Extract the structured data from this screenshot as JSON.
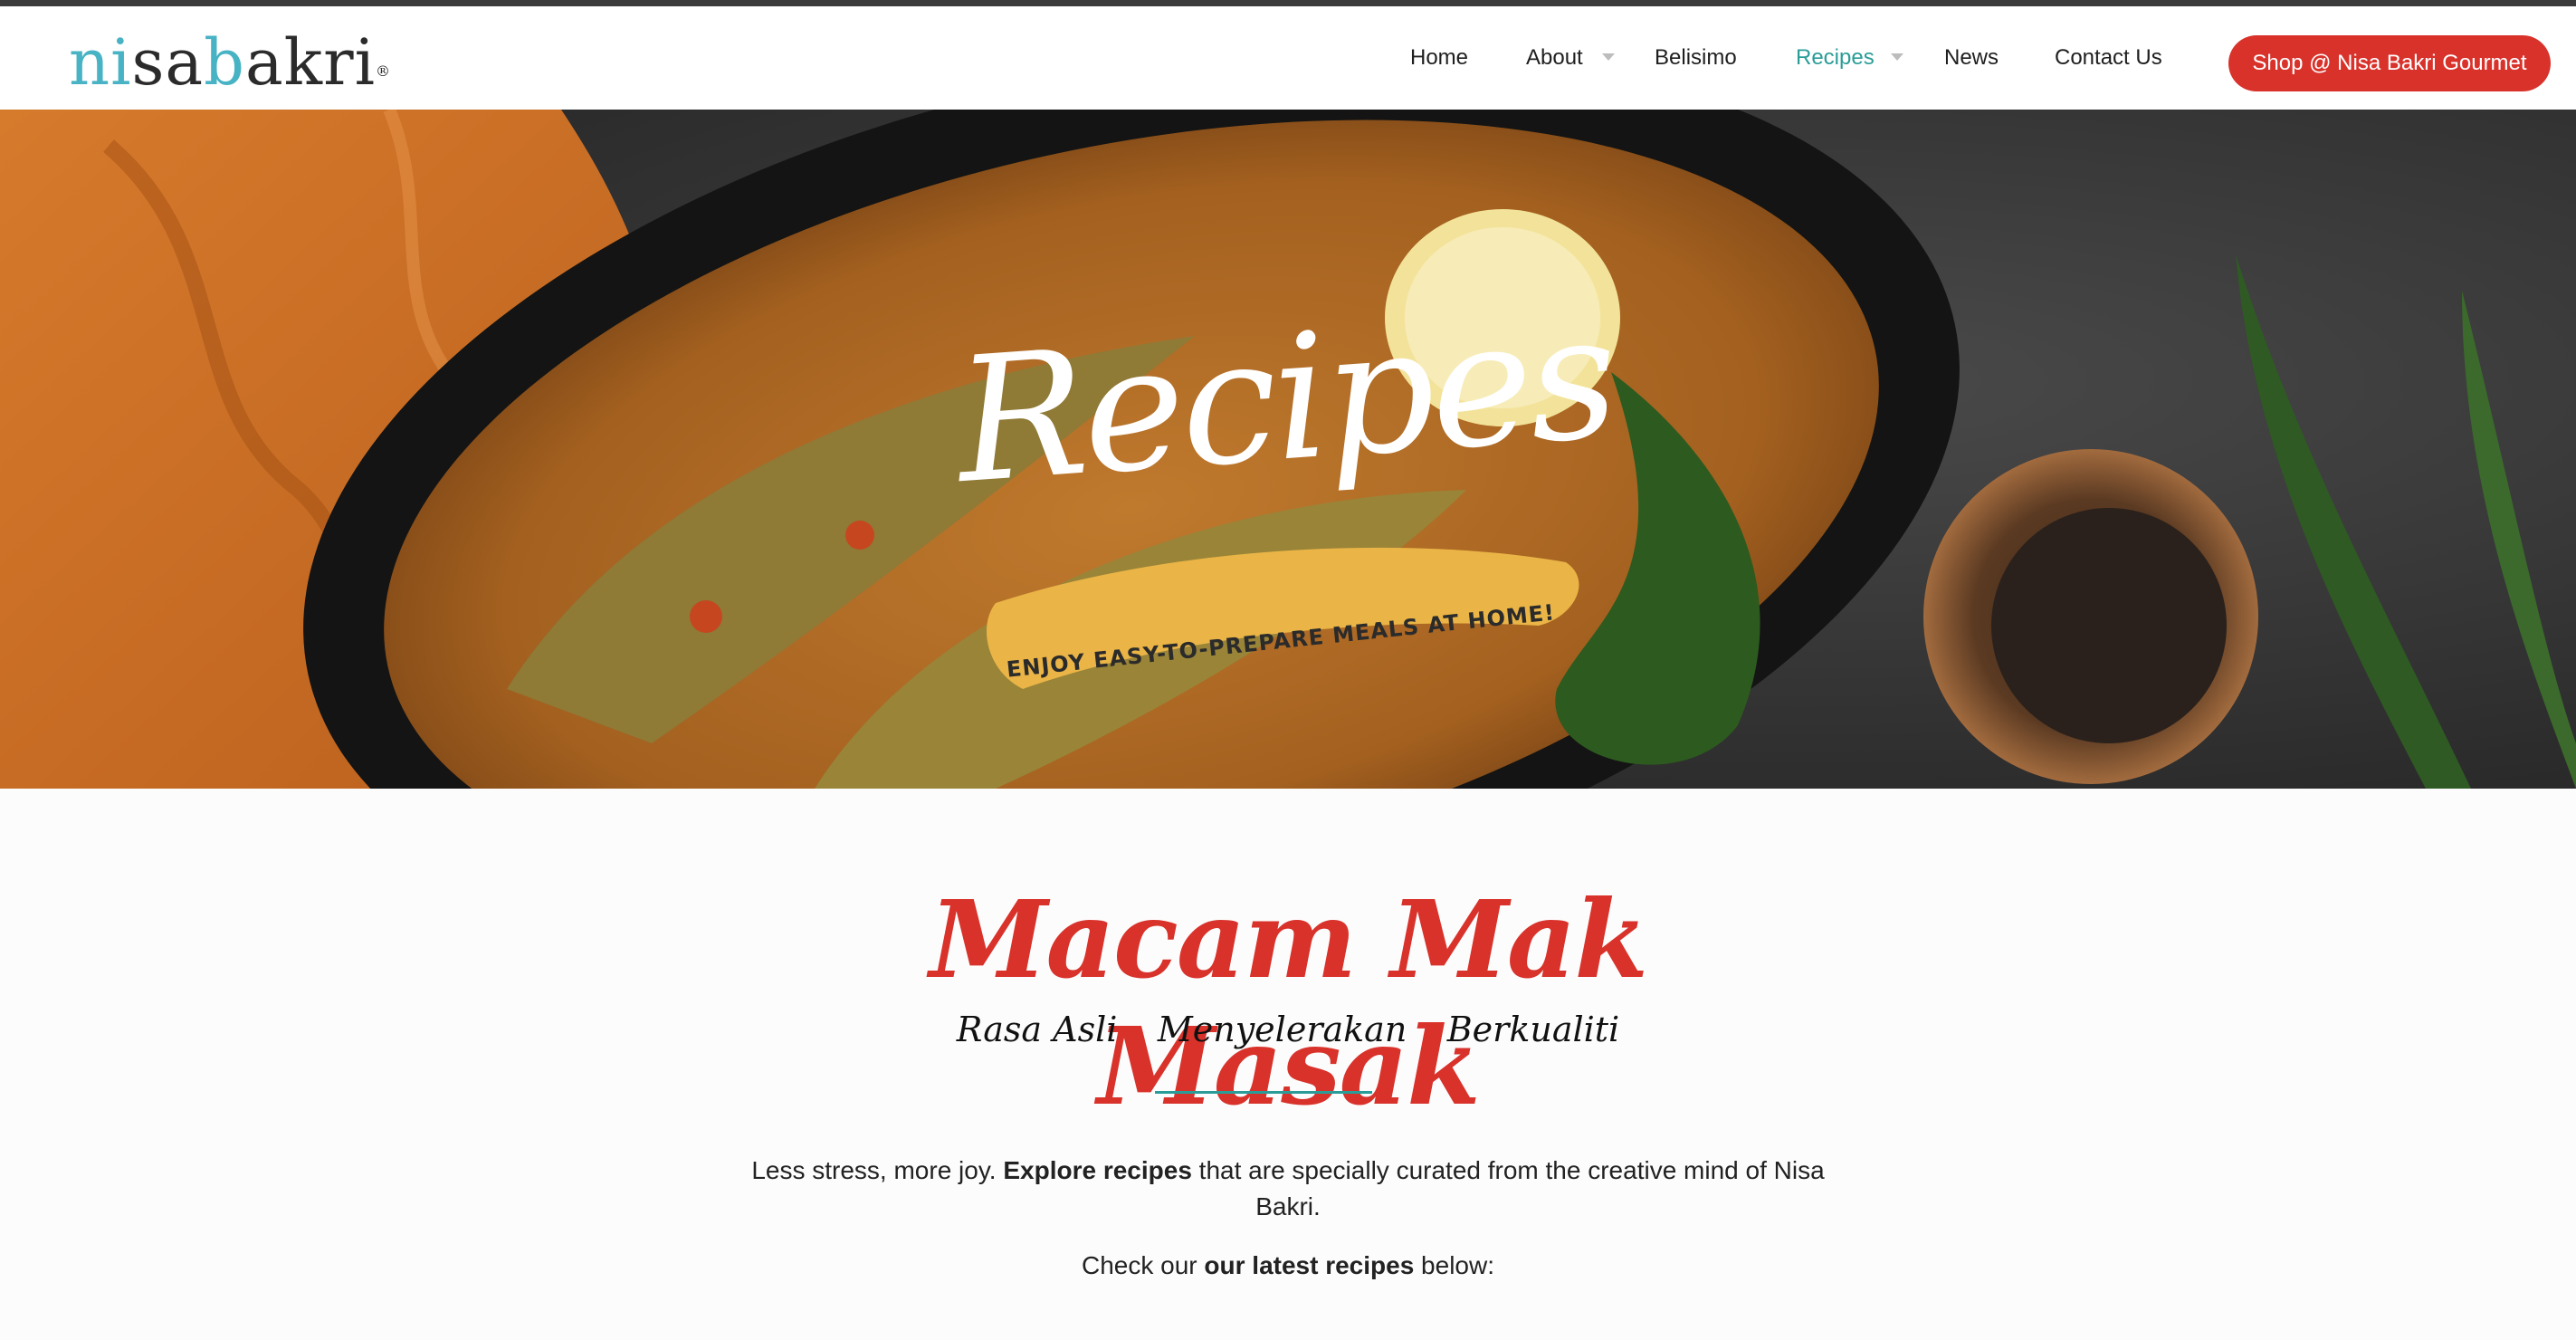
{
  "brand": {
    "logo_parts": [
      "ni",
      "sa",
      "b",
      "akri"
    ],
    "logo_reg": "®",
    "colors": {
      "teal": "#48b3c4",
      "dark": "#2b2b2b",
      "accent": "#d8322b",
      "active": "#2a9d98"
    }
  },
  "nav": {
    "items": [
      {
        "label": "Home",
        "dropdown": false
      },
      {
        "label": "About",
        "dropdown": true
      },
      {
        "label": "Belisimo",
        "dropdown": false
      },
      {
        "label": "Recipes",
        "dropdown": true,
        "active": true
      },
      {
        "label": "News",
        "dropdown": false
      },
      {
        "label": "Contact Us",
        "dropdown": false
      }
    ],
    "shop_button": "Shop @ Nisa Bakri Gourmet"
  },
  "hero": {
    "title": "Recipes",
    "tagline": "ENJOY EASY-TO-PREPARE MEALS AT HOME!"
  },
  "intro": {
    "script_title": "Macam Mak Masak",
    "sub_words": [
      "Rasa Asli",
      "Menyelerakan",
      "Berkualiti"
    ],
    "para1_a": "Less stress, more joy. ",
    "para1_b": "Explore recipes",
    "para1_c": " that are specially curated from the creative mind of Nisa Bakri.",
    "para2_a": "Check our ",
    "para2_b": "our latest recipes",
    "para2_c": " below:"
  }
}
